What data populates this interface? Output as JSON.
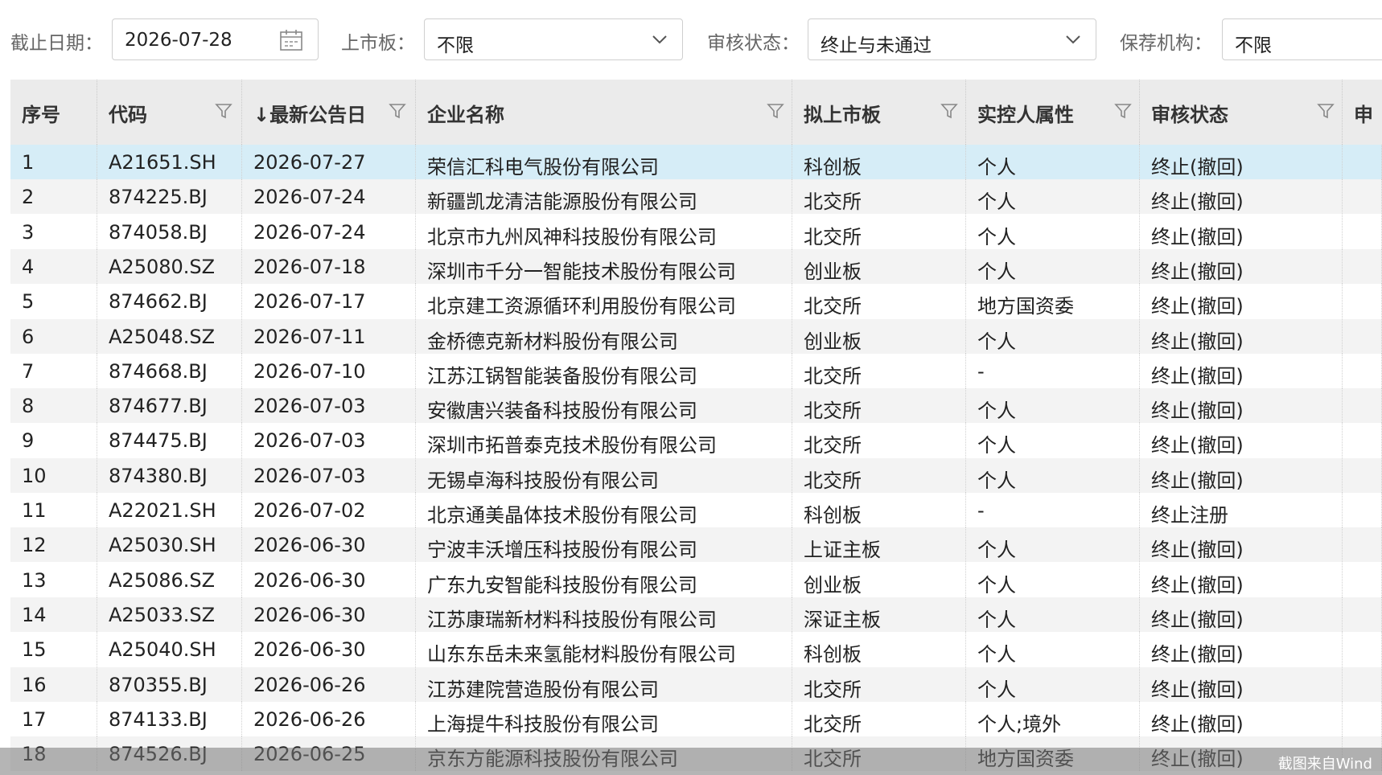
{
  "filters": {
    "deadline_label": "截止日期：",
    "deadline_value": "2026-07-28",
    "board_label": "上市板：",
    "board_value": "不限",
    "status_label": "审核状态：",
    "status_value": "终止与未通过",
    "sponsor_label": "保荐机构：",
    "sponsor_value": "不限"
  },
  "table": {
    "headers": {
      "idx": "序号",
      "code": "代码",
      "date": "↓最新公告日",
      "name": "企业名称",
      "board": "拟上市板",
      "owner": "实控人属性",
      "status": "审核状态",
      "extra": "申"
    },
    "rows": [
      {
        "idx": "1",
        "code": "A21651.SH",
        "date": "2026-07-27",
        "name": "荣信汇科电气股份有限公司",
        "board": "科创板",
        "owner": "个人",
        "status": "终止(撤回)"
      },
      {
        "idx": "2",
        "code": "874225.BJ",
        "date": "2026-07-24",
        "name": "新疆凯龙清洁能源股份有限公司",
        "board": "北交所",
        "owner": "个人",
        "status": "终止(撤回)"
      },
      {
        "idx": "3",
        "code": "874058.BJ",
        "date": "2026-07-24",
        "name": "北京市九州风神科技股份有限公司",
        "board": "北交所",
        "owner": "个人",
        "status": "终止(撤回)"
      },
      {
        "idx": "4",
        "code": "A25080.SZ",
        "date": "2026-07-18",
        "name": "深圳市千分一智能技术股份有限公司",
        "board": "创业板",
        "owner": "个人",
        "status": "终止(撤回)"
      },
      {
        "idx": "5",
        "code": "874662.BJ",
        "date": "2026-07-17",
        "name": "北京建工资源循环利用股份有限公司",
        "board": "北交所",
        "owner": "地方国资委",
        "status": "终止(撤回)"
      },
      {
        "idx": "6",
        "code": "A25048.SZ",
        "date": "2026-07-11",
        "name": "金桥德克新材料股份有限公司",
        "board": "创业板",
        "owner": "个人",
        "status": "终止(撤回)"
      },
      {
        "idx": "7",
        "code": "874668.BJ",
        "date": "2026-07-10",
        "name": "江苏江锅智能装备股份有限公司",
        "board": "北交所",
        "owner": "-",
        "status": "终止(撤回)"
      },
      {
        "idx": "8",
        "code": "874677.BJ",
        "date": "2026-07-03",
        "name": "安徽唐兴装备科技股份有限公司",
        "board": "北交所",
        "owner": "个人",
        "status": "终止(撤回)"
      },
      {
        "idx": "9",
        "code": "874475.BJ",
        "date": "2026-07-03",
        "name": "深圳市拓普泰克技术股份有限公司",
        "board": "北交所",
        "owner": "个人",
        "status": "终止(撤回)"
      },
      {
        "idx": "10",
        "code": "874380.BJ",
        "date": "2026-07-03",
        "name": "无锡卓海科技股份有限公司",
        "board": "北交所",
        "owner": "个人",
        "status": "终止(撤回)"
      },
      {
        "idx": "11",
        "code": "A22021.SH",
        "date": "2026-07-02",
        "name": "北京通美晶体技术股份有限公司",
        "board": "科创板",
        "owner": "-",
        "status": "终止注册"
      },
      {
        "idx": "12",
        "code": "A25030.SH",
        "date": "2026-06-30",
        "name": "宁波丰沃增压科技股份有限公司",
        "board": "上证主板",
        "owner": "个人",
        "status": "终止(撤回)"
      },
      {
        "idx": "13",
        "code": "A25086.SZ",
        "date": "2026-06-30",
        "name": "广东九安智能科技股份有限公司",
        "board": "创业板",
        "owner": "个人",
        "status": "终止(撤回)"
      },
      {
        "idx": "14",
        "code": "A25033.SZ",
        "date": "2026-06-30",
        "name": "江苏康瑞新材料科技股份有限公司",
        "board": "深证主板",
        "owner": "个人",
        "status": "终止(撤回)"
      },
      {
        "idx": "15",
        "code": "A25040.SH",
        "date": "2026-06-30",
        "name": "山东东岳未来氢能材料股份有限公司",
        "board": "科创板",
        "owner": "个人",
        "status": "终止(撤回)"
      },
      {
        "idx": "16",
        "code": "870355.BJ",
        "date": "2026-06-26",
        "name": "江苏建院营造股份有限公司",
        "board": "北交所",
        "owner": "个人",
        "status": "终止(撤回)"
      },
      {
        "idx": "17",
        "code": "874133.BJ",
        "date": "2026-06-26",
        "name": "上海提牛科技股份有限公司",
        "board": "北交所",
        "owner": "个人;境外",
        "status": "终止(撤回)"
      },
      {
        "idx": "18",
        "code": "874526.BJ",
        "date": "2026-06-25",
        "name": "京东方能源科技股份有限公司",
        "board": "北交所",
        "owner": "地方国资委",
        "status": "终止(撤回)"
      }
    ]
  },
  "watermark": "截图来自Wind",
  "colors": {
    "selected_row": "#d6edf7",
    "header_bg": "#ebebeb",
    "striped_row": "#f3f3f3"
  },
  "icons": {
    "calendar": "calendar-icon",
    "dropdown": "chevron-down-icon",
    "filter": "filter-funnel-icon"
  }
}
